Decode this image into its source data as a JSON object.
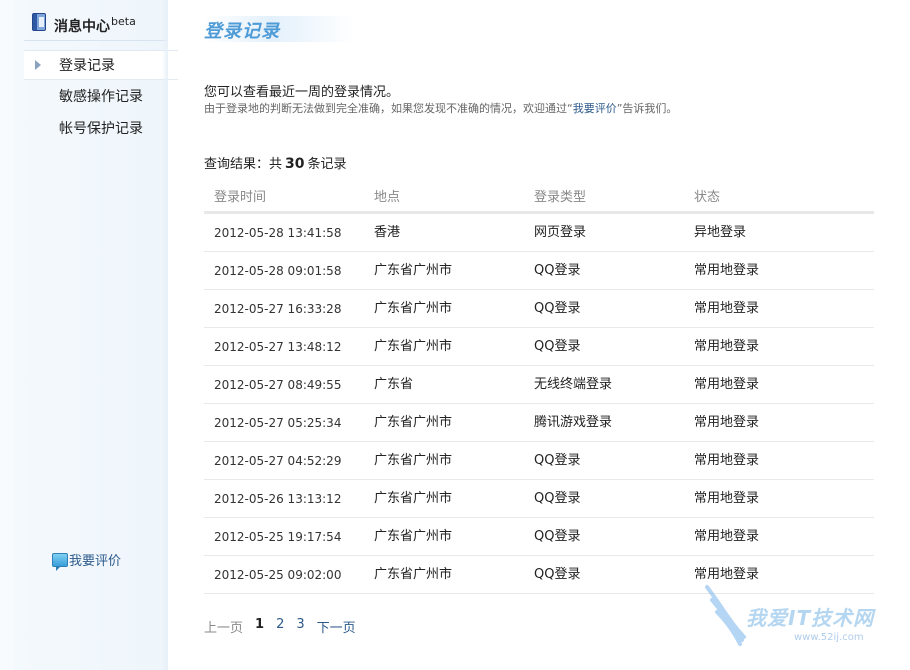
{
  "sidebar": {
    "title": "消息中心",
    "title_sup": "beta",
    "items": [
      {
        "label": "登录记录",
        "active": true
      },
      {
        "label": "敏感操作记录",
        "active": false
      },
      {
        "label": "帐号保护记录",
        "active": false
      }
    ],
    "feedback_label": "我要评价"
  },
  "main": {
    "title": "登录记录",
    "intro": "您可以查看最近一周的登录情况。",
    "note_prefix": "由于登录地的判断无法做到完全准确，如果您发现不准确的情况，欢迎通过“",
    "note_link": "我要评价",
    "note_suffix": "”告诉我们。",
    "result_prefix": "查询结果：共",
    "result_count": "30",
    "result_suffix": "条记录"
  },
  "table": {
    "headers": [
      "登录时间",
      "地点",
      "登录类型",
      "状态"
    ],
    "rows": [
      [
        "2012-05-28 13:41:58",
        "香港",
        "网页登录",
        "异地登录"
      ],
      [
        "2012-05-28 09:01:58",
        "广东省广州市",
        "QQ登录",
        "常用地登录"
      ],
      [
        "2012-05-27 16:33:28",
        "广东省广州市",
        "QQ登录",
        "常用地登录"
      ],
      [
        "2012-05-27 13:48:12",
        "广东省广州市",
        "QQ登录",
        "常用地登录"
      ],
      [
        "2012-05-27 08:49:55",
        "广东省",
        "无线终端登录",
        "常用地登录"
      ],
      [
        "2012-05-27 05:25:34",
        "广东省广州市",
        "腾讯游戏登录",
        "常用地登录"
      ],
      [
        "2012-05-27 04:52:29",
        "广东省广州市",
        "QQ登录",
        "常用地登录"
      ],
      [
        "2012-05-26 13:13:12",
        "广东省广州市",
        "QQ登录",
        "常用地登录"
      ],
      [
        "2012-05-25 19:17:54",
        "广东省广州市",
        "QQ登录",
        "常用地登录"
      ],
      [
        "2012-05-25 09:02:00",
        "广东省广州市",
        "QQ登录",
        "常用地登录"
      ]
    ]
  },
  "pager": {
    "prev": "上一页",
    "pages": [
      "1",
      "2",
      "3"
    ],
    "current": "1",
    "next": "下一页"
  },
  "watermark": {
    "text": "我爱IT技术网",
    "url": "www.52ij.com"
  },
  "icons": {
    "sidebar_header": "book-icon",
    "feedback": "chat-bubble-icon",
    "active_marker": "triangle-right-icon"
  }
}
